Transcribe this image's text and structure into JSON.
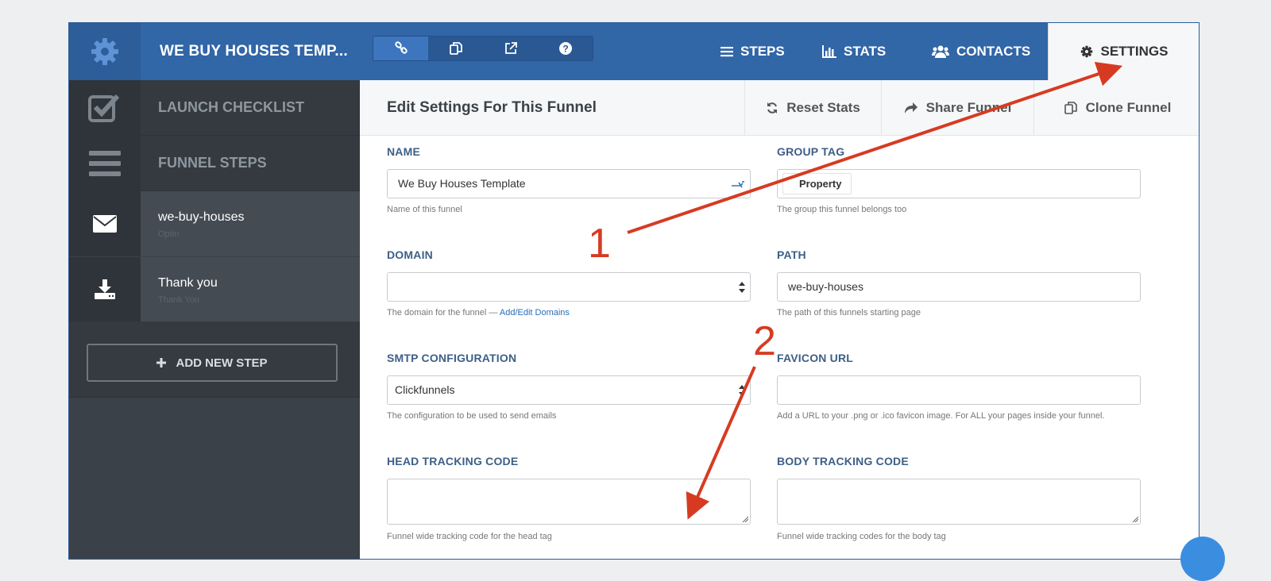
{
  "header": {
    "funnel_title": "WE BUY HOUSES TEMP...",
    "nav": [
      {
        "label": "STEPS",
        "icon": "list-icon"
      },
      {
        "label": "STATS",
        "icon": "bar-chart-icon"
      },
      {
        "label": "CONTACTS",
        "icon": "users-icon"
      },
      {
        "label": "SETTINGS",
        "icon": "gear-icon"
      }
    ]
  },
  "sidebar": {
    "launch_checklist": "LAUNCH CHECKLIST",
    "funnel_steps": "FUNNEL STEPS",
    "steps": [
      {
        "name": "we-buy-houses",
        "type": "Optin"
      },
      {
        "name": "Thank you",
        "type": "Thank You"
      }
    ],
    "add_step": "ADD NEW STEP"
  },
  "main": {
    "title": "Edit Settings For This Funnel",
    "reset_stats": "Reset Stats",
    "share_funnel": "Share Funnel",
    "clone_funnel": "Clone Funnel"
  },
  "form": {
    "name": {
      "label": "NAME",
      "value": "We Buy Houses Template",
      "hint": "Name of this funnel"
    },
    "group_tag": {
      "label": "GROUP TAG",
      "value": "Property",
      "hint": "The group this funnel belongs too"
    },
    "domain": {
      "label": "DOMAIN",
      "value": "",
      "hint": "The domain for the funnel —",
      "hint_link": "Add/Edit Domains"
    },
    "path": {
      "label": "PATH",
      "value": "we-buy-houses",
      "hint": "The path of this funnels starting page"
    },
    "smtp": {
      "label": "SMTP CONFIGURATION",
      "value": "Clickfunnels",
      "hint": "The configuration to be used to send emails"
    },
    "favicon": {
      "label": "FAVICON URL",
      "value": "",
      "hint": "Add a URL to your .png or .ico favicon image. For ALL your pages inside your funnel."
    },
    "head_code": {
      "label": "HEAD TRACKING CODE",
      "value": "",
      "hint": "Funnel wide tracking code for the head tag"
    },
    "body_code": {
      "label": "BODY TRACKING CODE",
      "value": "",
      "hint": "Funnel wide tracking codes for the body tag"
    }
  },
  "annotations": {
    "one": "1",
    "two": "2"
  },
  "colors": {
    "primary": "#3166a7",
    "sidebar": "#3b4148",
    "arrow": "#d63b22"
  }
}
